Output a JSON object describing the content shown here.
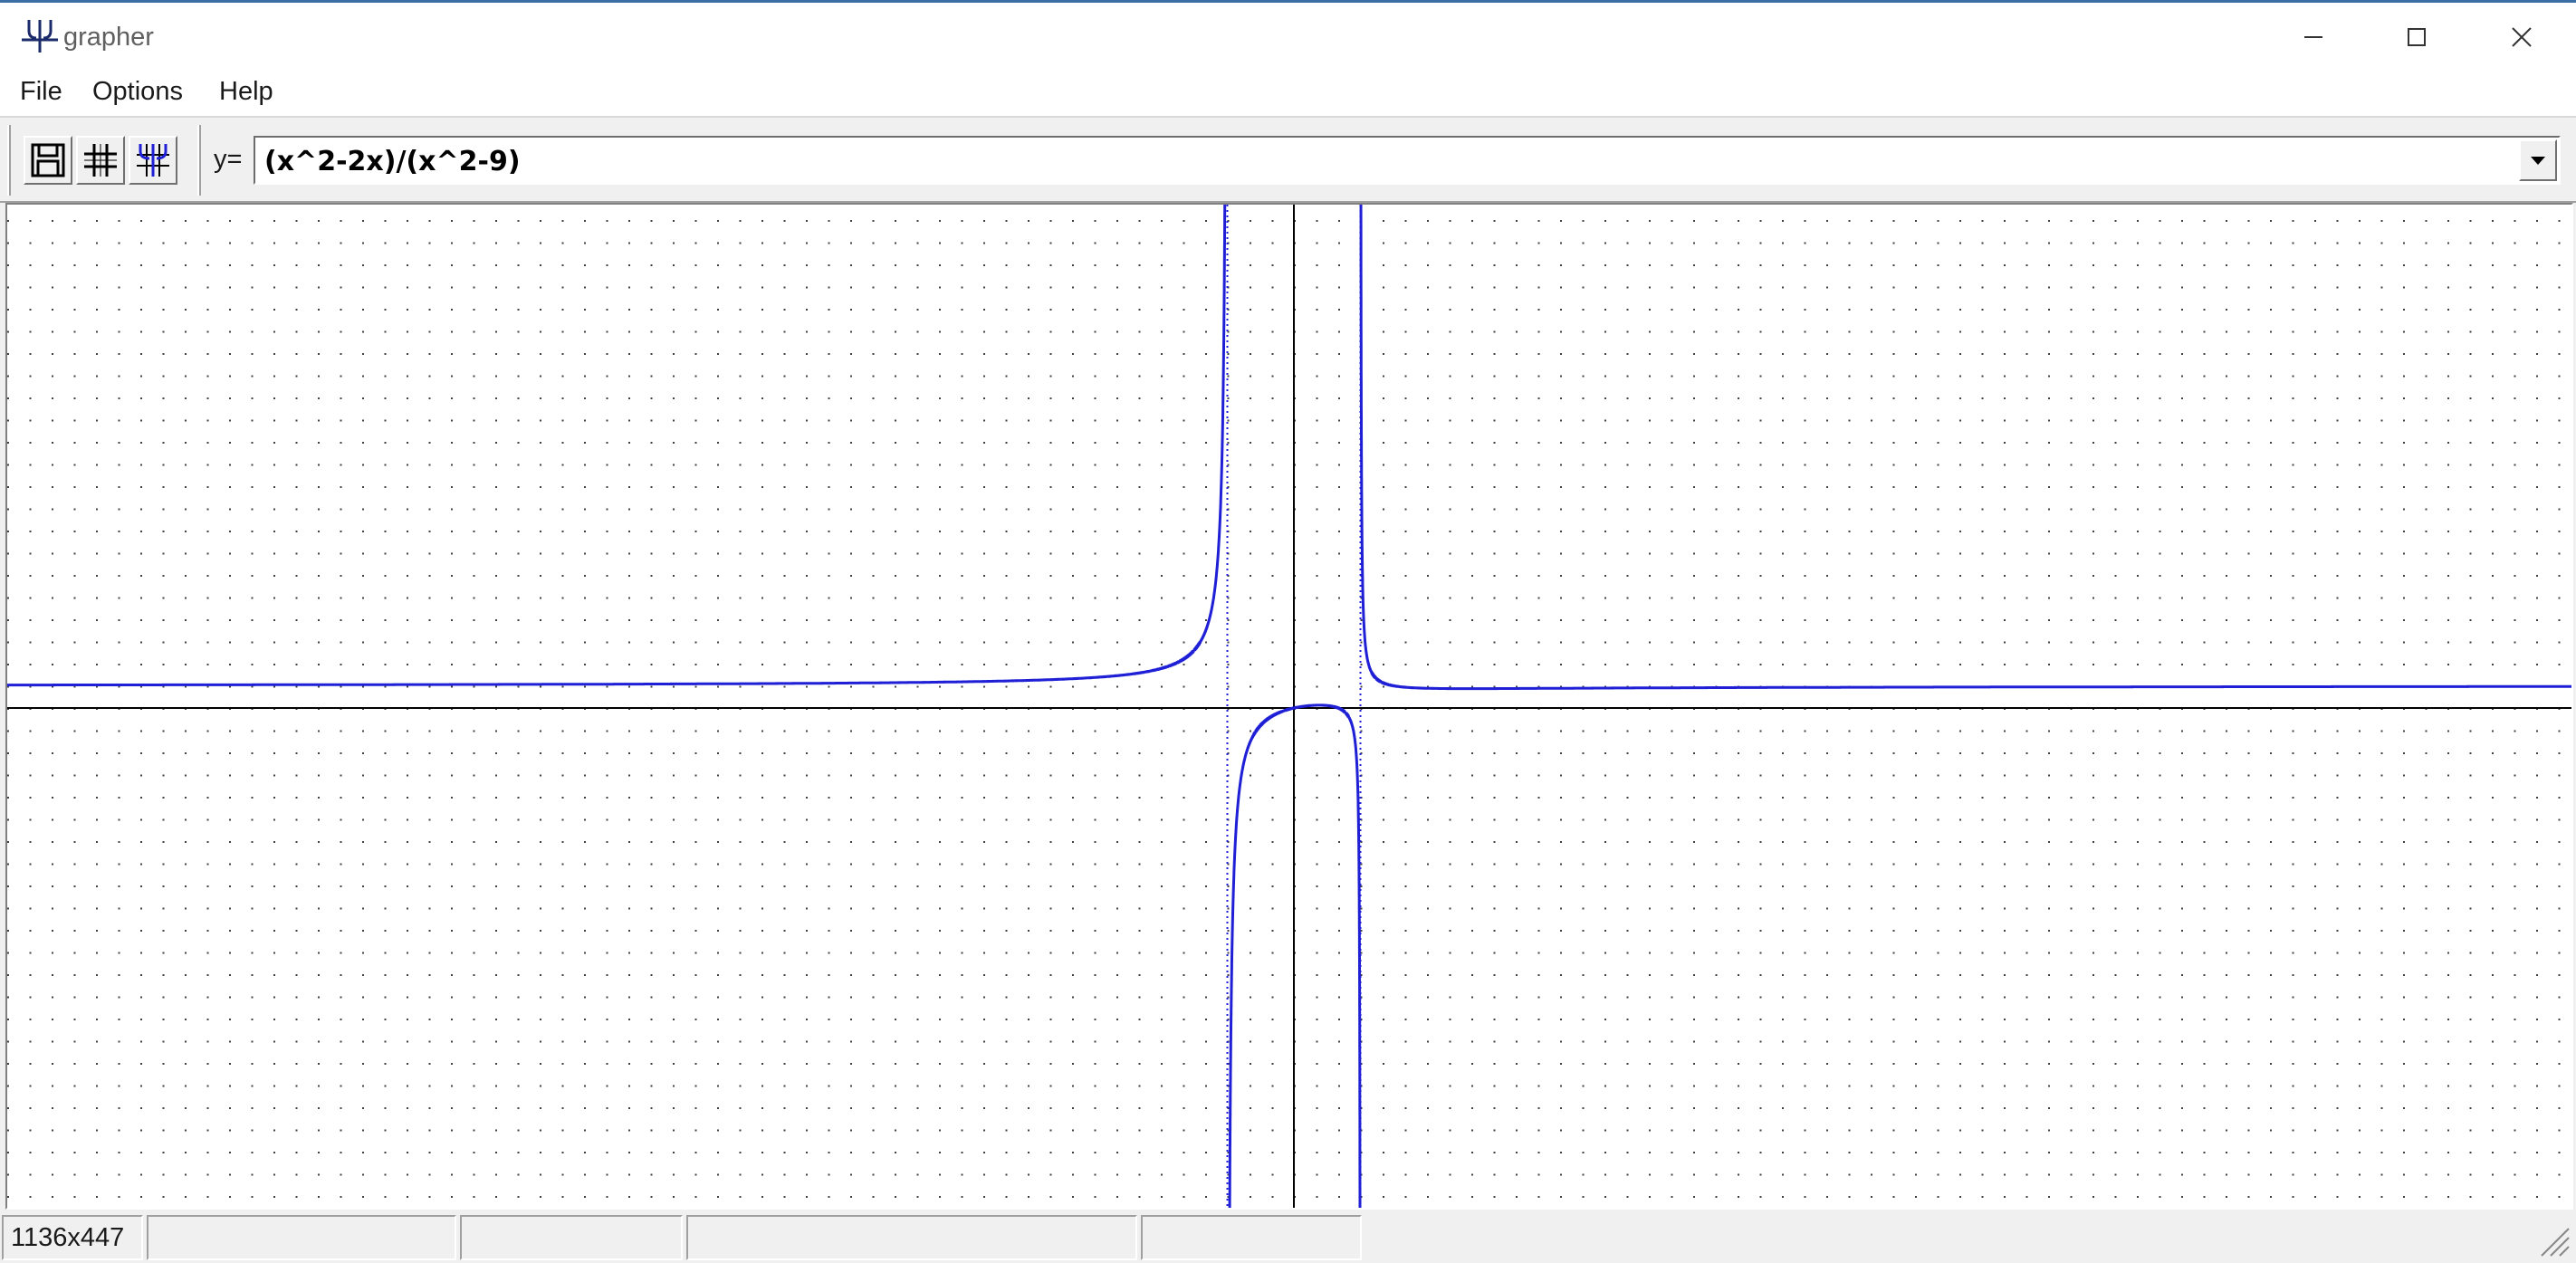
{
  "window": {
    "title": "grapher",
    "icon": "grapher-logo-icon",
    "controls": [
      "minimize-icon",
      "maximize-icon",
      "close-icon"
    ]
  },
  "menu": {
    "items": [
      {
        "label": "File"
      },
      {
        "label": "Options"
      },
      {
        "label": "Help"
      }
    ]
  },
  "toolbar": {
    "buttons": [
      {
        "icon": "save-icon"
      },
      {
        "icon": "grid-icon"
      },
      {
        "icon": "axes-icon"
      }
    ],
    "y_label": "y=",
    "function_input": "(x^2-2x)/(x^2-9)",
    "dropdown_icon": "dropdown-arrow-icon"
  },
  "graph": {
    "function": "(x^2-2x)/(x^2-9)",
    "curve_color": "#1f1fd6",
    "axis_color": "#000000",
    "grid_dot_color": "#404040",
    "asymptote_color": "#1f1fd6",
    "vertical_asymptotes": [
      -3,
      3
    ],
    "horizontal_asymptote": 1
  },
  "status": {
    "panes": [
      "1136x447",
      "",
      "",
      "",
      "",
      ""
    ]
  }
}
